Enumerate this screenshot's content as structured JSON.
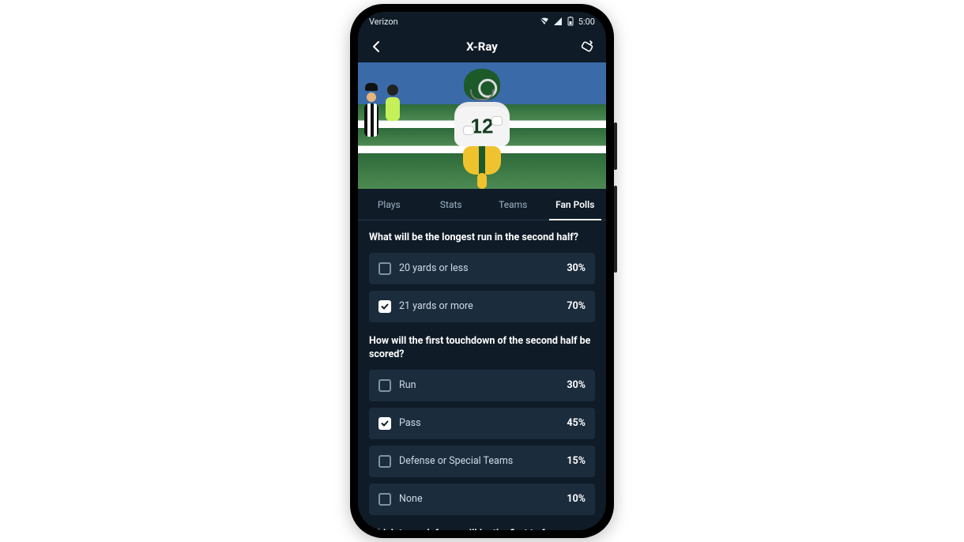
{
  "statusbar": {
    "carrier": "Verizon",
    "time": "5:00"
  },
  "titlebar": {
    "title": "X-Ray"
  },
  "hero": {
    "jersey_number": "12"
  },
  "tabs": [
    {
      "id": "plays",
      "label": "Plays",
      "active": false
    },
    {
      "id": "stats",
      "label": "Stats",
      "active": false
    },
    {
      "id": "teams",
      "label": "Teams",
      "active": false
    },
    {
      "id": "fanpolls",
      "label": "Fan Polls",
      "active": true
    }
  ],
  "polls": [
    {
      "question": "What will be the longest run in the second half?",
      "options": [
        {
          "label": "20 yards or less",
          "percent": "30%",
          "checked": false
        },
        {
          "label": "21 yards or more",
          "percent": "70%",
          "checked": true
        }
      ]
    },
    {
      "question": "How will the first touchdown of the second half be scored?",
      "options": [
        {
          "label": "Run",
          "percent": "30%",
          "checked": false
        },
        {
          "label": "Pass",
          "percent": "45%",
          "checked": true
        },
        {
          "label": "Defense or Special Teams",
          "percent": "15%",
          "checked": false
        },
        {
          "label": "None",
          "percent": "10%",
          "checked": false
        }
      ]
    },
    {
      "question": "Which team defense will be the first to force a",
      "options": []
    }
  ]
}
